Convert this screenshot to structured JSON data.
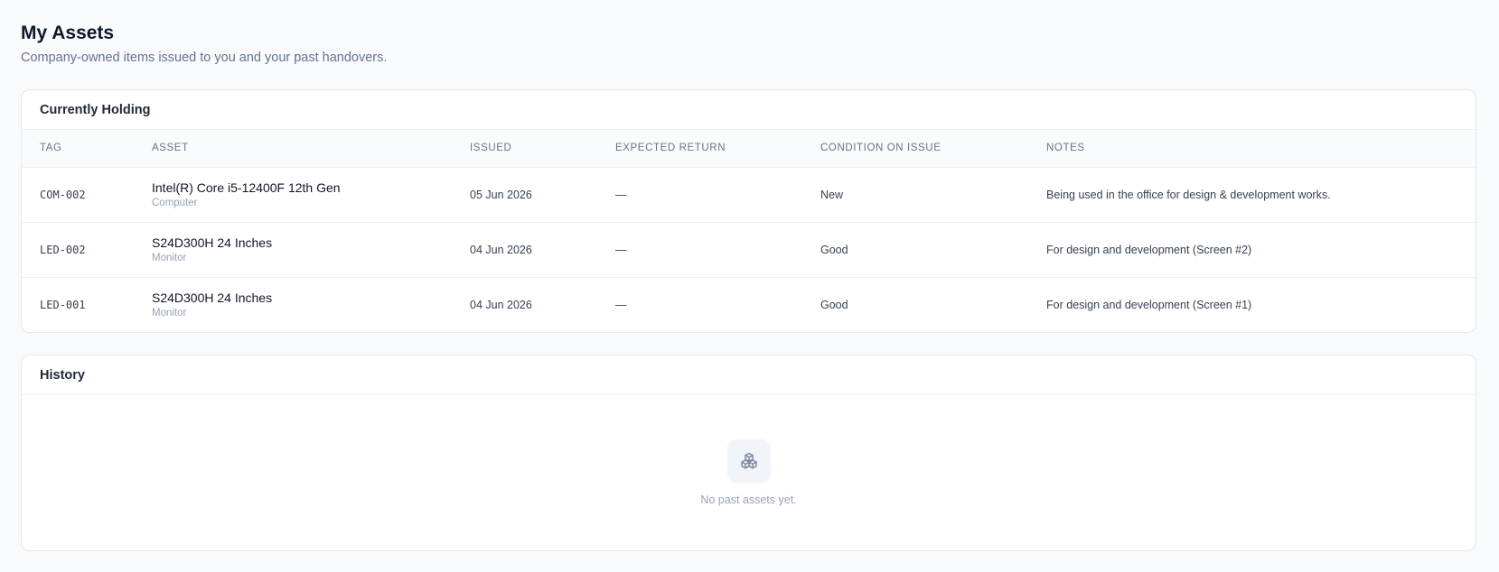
{
  "page": {
    "title": "My Assets",
    "subtitle": "Company-owned items issued to you and your past handovers."
  },
  "holding": {
    "title": "Currently Holding",
    "columns": [
      "TAG",
      "ASSET",
      "ISSUED",
      "EXPECTED RETURN",
      "CONDITION ON ISSUE",
      "NOTES"
    ],
    "rows": [
      {
        "tag": "COM-002",
        "asset_name": "Intel(R) Core i5-12400F 12th Gen",
        "asset_type": "Computer",
        "issued": "05 Jun 2026",
        "expected_return": "—",
        "condition": "New",
        "notes": "Being used in the office for design & development works."
      },
      {
        "tag": "LED-002",
        "asset_name": "S24D300H 24 Inches",
        "asset_type": "Monitor",
        "issued": "04 Jun 2026",
        "expected_return": "—",
        "condition": "Good",
        "notes": "For design and development (Screen #2)"
      },
      {
        "tag": "LED-001",
        "asset_name": "S24D300H 24 Inches",
        "asset_type": "Monitor",
        "issued": "04 Jun 2026",
        "expected_return": "—",
        "condition": "Good",
        "notes": "For design and development (Screen #1)"
      }
    ]
  },
  "history": {
    "title": "History",
    "empty_icon": "boxes-icon",
    "empty_text": "No past assets yet."
  },
  "colors": {
    "background": "#f8fafc",
    "card": "#ffffff",
    "border": "#e5e7eb",
    "muted_text": "#64748b"
  }
}
